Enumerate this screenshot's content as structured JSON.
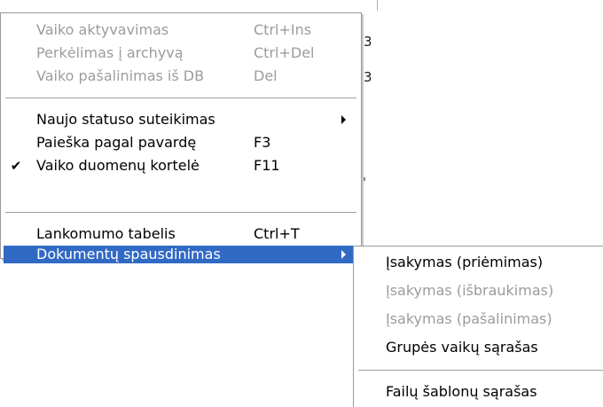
{
  "main_menu": {
    "items": [
      {
        "label": "Vaiko aktyvavimas",
        "shortcut": "Ctrl+Ins",
        "state": "disabled"
      },
      {
        "label": "Perkėlimas į archyvą",
        "shortcut": "Ctrl+Del",
        "state": "disabled"
      },
      {
        "label": "Vaiko pašalinimas iš DB",
        "shortcut": "Del",
        "state": "disabled"
      },
      {
        "label": "Naujo statuso suteikimas",
        "shortcut": "",
        "state": "enabled",
        "submenu": true
      },
      {
        "label": "Paieška pagal pavardę",
        "shortcut": "F3",
        "state": "enabled"
      },
      {
        "label": "Vaiko duomenų kortelė",
        "shortcut": "F11",
        "state": "enabled",
        "checked": true,
        "check_glyph": "✔"
      },
      {
        "label": "Lankomumo tabelis",
        "shortcut": "Ctrl+T",
        "state": "enabled"
      },
      {
        "label": "Dokumentų spausdinimas",
        "shortcut": "",
        "state": "highlighted",
        "submenu": true
      }
    ]
  },
  "sub_menu": {
    "items": [
      {
        "label": "Įsakymas (priėmimas)",
        "state": "enabled"
      },
      {
        "label": "Įsakymas (išbraukimas)",
        "state": "disabled"
      },
      {
        "label": "Įsakymas (pašalinimas)",
        "state": "disabled"
      },
      {
        "label": "Grupės vaikų sąrašas",
        "state": "enabled"
      },
      {
        "label": "Failų šablonų sąrašas",
        "state": "enabled"
      }
    ]
  },
  "colors": {
    "highlight": "#316ac5",
    "disabled_text": "#9c9c9c",
    "menu_background": "#ffffff"
  },
  "icons": {
    "check": "check-icon",
    "submenu_arrow": "submenu-arrow-icon"
  }
}
